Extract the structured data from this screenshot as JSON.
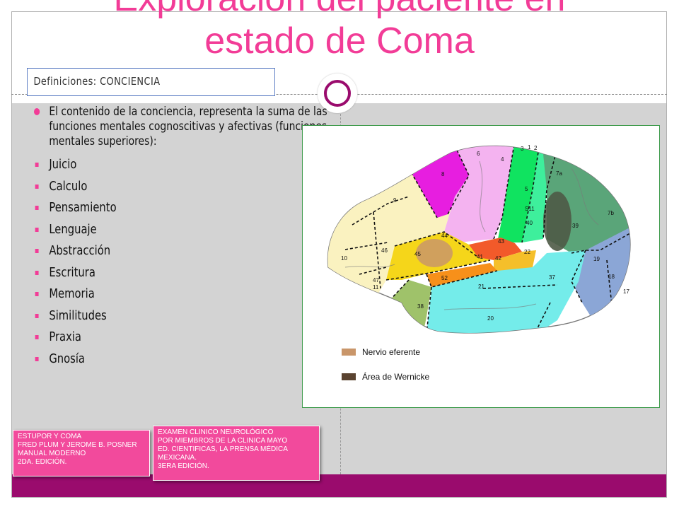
{
  "slide": {
    "title_line1": "Exploración del paciente en",
    "title_line2": "estado de Coma",
    "subtitle": "Definiciones: CONCIENCIA"
  },
  "content": {
    "intro": "El contenido de la conciencia, representa la suma de las funciones mentales cognoscitivas y afectivas (funciones mentales superiores):",
    "items": [
      "Juicio",
      "Calculo",
      "Pensamiento",
      "Lenguaje",
      "Abstracción",
      "Escritura",
      "Memoria",
      "Similitudes",
      "Praxia",
      "Gnosía"
    ]
  },
  "figure": {
    "legend": [
      {
        "label": "Nervio eferente",
        "color": "#c9966a"
      },
      {
        "label": "Área de Wernicke",
        "color": "#5a4330"
      }
    ],
    "area_numbers": [
      "3",
      "1",
      "2",
      "6",
      "4",
      "8",
      "7a",
      "9",
      "5",
      "S11",
      "40",
      "39",
      "7b",
      "44",
      "10",
      "46",
      "45",
      "43",
      "22",
      "41",
      "42",
      "19",
      "47",
      "11",
      "52",
      "37",
      "18",
      "21",
      "17",
      "38",
      "20"
    ]
  },
  "references": {
    "ref1": [
      "ESTUPOR Y COMA",
      "FRED PLUM Y JEROME B. POSNER",
      "MANUAL MODERNO",
      "2DA. EDICIÓN."
    ],
    "ref2": [
      "EXAMEN CLINICO NEUROLÓGICO",
      "POR MIEMBROS DE LA CLINICA MAYO",
      "ED. CIENTIFICAS, LA PRENSA MÉDICA",
      "MEXICANA.",
      "3ERA EDICIÓN."
    ]
  },
  "colors": {
    "accent_pink": "#f23c97",
    "bar_purple": "#9a0b6d",
    "content_gray": "#d3d3d3"
  }
}
